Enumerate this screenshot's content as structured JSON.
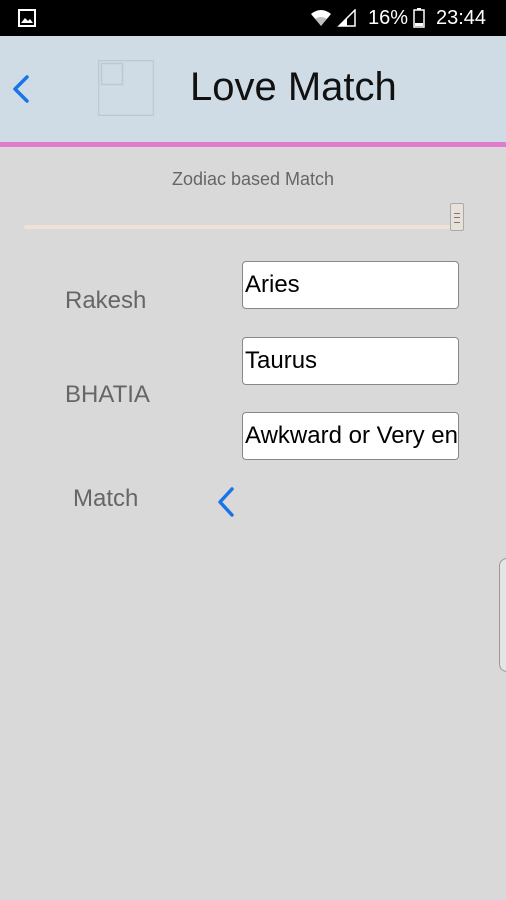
{
  "status_bar": {
    "battery_percent": "16%",
    "time": "23:44",
    "icons": [
      "gallery-icon",
      "wifi-icon",
      "signal-icon",
      "battery-icon"
    ]
  },
  "header": {
    "title": "Love Match",
    "back_icon": "chevron-left-icon",
    "logo_icon": "image-placeholder-icon"
  },
  "content": {
    "subtitle": "Zodiac based Match",
    "slider_value": 1.0,
    "name1_label": "Rakesh",
    "name2_label": "BHATIA",
    "match_label": "Match",
    "sign1_value": "Aries",
    "sign2_value": "Taurus",
    "result_value": "Awkward or Very energetic"
  },
  "colors": {
    "status_bar_bg": "#000000",
    "header_bg": "#cfdce6",
    "accent_line": "#e07ccc",
    "page_bg": "#d9d9d9",
    "link_blue": "#1a73e8"
  }
}
